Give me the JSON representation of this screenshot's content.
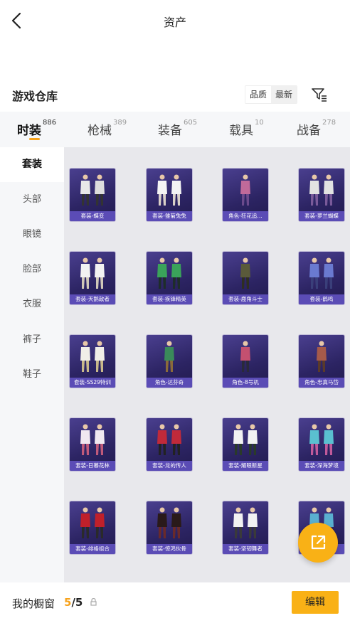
{
  "header": {
    "title": "资产",
    "back_icon": "chevron-left-icon"
  },
  "section": {
    "title": "游戏仓库",
    "sort_options": [
      {
        "label": "品质",
        "active": false
      },
      {
        "label": "最新",
        "active": true
      }
    ],
    "filter_icon": "filter-list-icon"
  },
  "tabs": [
    {
      "label": "时装",
      "count": "886",
      "active": true
    },
    {
      "label": "枪械",
      "count": "389",
      "active": false
    },
    {
      "label": "装备",
      "count": "605",
      "active": false
    },
    {
      "label": "载具",
      "count": "10",
      "active": false
    },
    {
      "label": "战备",
      "count": "278",
      "active": false
    }
  ],
  "sidebar": {
    "items": [
      {
        "label": "套装",
        "active": true
      },
      {
        "label": "头部",
        "active": false
      },
      {
        "label": "眼镜",
        "active": false
      },
      {
        "label": "脸部",
        "active": false
      },
      {
        "label": "衣服",
        "active": false
      },
      {
        "label": "裤子",
        "active": false
      },
      {
        "label": "鞋子",
        "active": false
      }
    ]
  },
  "items": [
    {
      "caption": "套装-蝶变",
      "figure": "pair"
    },
    {
      "caption": "套装-雏菊兔兔",
      "figure": "pair"
    },
    {
      "caption": "角色-狂花追…",
      "figure": "single"
    },
    {
      "caption": "套装-萝兰蝴蝶",
      "figure": "pair"
    },
    {
      "caption": "套装-天鹅敌者",
      "figure": "pair"
    },
    {
      "caption": "套装-疾锋精英",
      "figure": "pair"
    },
    {
      "caption": "套装-鹿角斗士",
      "figure": "single"
    },
    {
      "caption": "套装-鹤鸣",
      "figure": "pair"
    },
    {
      "caption": "套装-SS29特训",
      "figure": "pair"
    },
    {
      "caption": "角色-达芬奇",
      "figure": "single"
    },
    {
      "caption": "角色-8号机",
      "figure": "single"
    },
    {
      "caption": "角色-忠真马岱",
      "figure": "single"
    },
    {
      "caption": "套装-日暮花林",
      "figure": "pair"
    },
    {
      "caption": "套装-龙的传人",
      "figure": "pair"
    },
    {
      "caption": "套装-耀眼新星",
      "figure": "pair"
    },
    {
      "caption": "套装-深海梦境",
      "figure": "pair"
    },
    {
      "caption": "套装-绯格组合",
      "figure": "pair"
    },
    {
      "caption": "套装-惊鸿伙骨",
      "figure": "pair"
    },
    {
      "caption": "套装-坚韧舞者",
      "figure": "pair"
    },
    {
      "caption": "…",
      "figure": "pair"
    }
  ],
  "fab": {
    "icon": "share-external-icon"
  },
  "bottom": {
    "label": "我的橱窗",
    "count_used": "5",
    "count_sep": "/",
    "count_total": "5",
    "lock_icon": "lock-icon",
    "edit_label": "编辑"
  },
  "colors": {
    "accent": "#f9b116",
    "card_bg": "#2c2463",
    "caption_bg": "#5f50be"
  }
}
